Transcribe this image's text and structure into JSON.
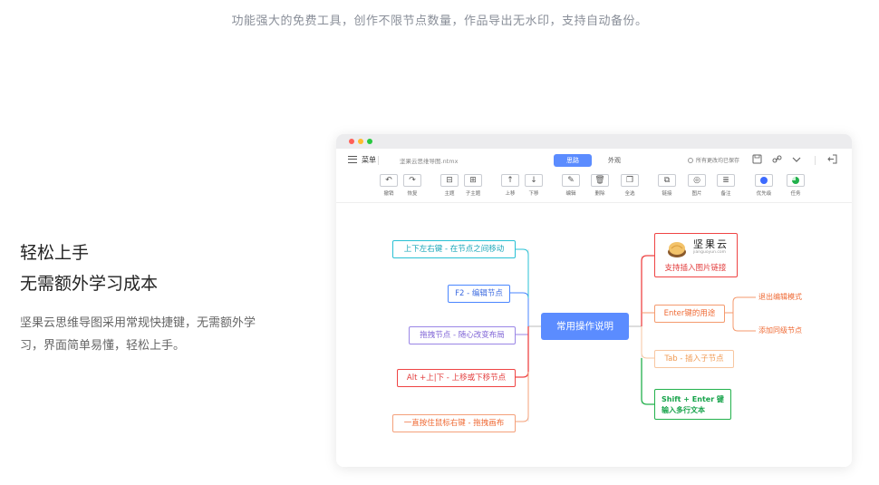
{
  "page": {
    "tagline": "功能强大的免费工具，创作不限节点数量，作品导出无水印，支持自动备份。",
    "feature_title_1": "轻松上手",
    "feature_title_2": "无需额外学习成本",
    "feature_desc": "坚果云思维导图采用常规快捷键，无需额外学习，界面简单易懂，轻松上手。"
  },
  "app": {
    "menu_label": "菜单",
    "filename": "坚果云思维导图.ntmx",
    "tabs": [
      {
        "label": "思路",
        "active": true
      },
      {
        "label": "外观",
        "active": false
      }
    ],
    "save_status": "所有更改均已保存",
    "topbar_icons": [
      "save-icon",
      "link-icon",
      "chevron-down-icon",
      "exit-icon"
    ],
    "toolbar": [
      {
        "label": "撤销",
        "icon": "undo-icon"
      },
      {
        "label": "恢复",
        "icon": "redo-icon"
      },
      {
        "label": "主题",
        "icon": "topic-icon"
      },
      {
        "label": "子主题",
        "icon": "subtopic-icon"
      },
      {
        "label": "上移",
        "icon": "arrow-up-icon"
      },
      {
        "label": "下移",
        "icon": "arrow-down-icon"
      },
      {
        "label": "编辑",
        "icon": "edit-icon"
      },
      {
        "label": "删除",
        "icon": "trash-icon"
      },
      {
        "label": "全选",
        "icon": "select-all-icon"
      },
      {
        "label": "链接",
        "icon": "link-icon"
      },
      {
        "label": "图片",
        "icon": "image-icon"
      },
      {
        "label": "备注",
        "icon": "note-icon"
      },
      {
        "label": "优先级",
        "icon": "priority-icon"
      },
      {
        "label": "任务",
        "icon": "task-progress-icon"
      }
    ]
  },
  "mindmap": {
    "center": "常用操作说明",
    "left": [
      "上下左右键 - 在节点之间移动",
      "F2 - 编辑节点",
      "拖拽节点 - 随心改变布局",
      "Alt +上|下 - 上移或下移节点",
      "一直按住鼠标右键 - 拖拽画布"
    ],
    "right_image_node": {
      "logo_text": "坚果云",
      "logo_sub": "jianguoyun.com",
      "caption": "支持插入图片链接"
    },
    "right": [
      "Enter键的用途",
      "Tab - 插入子节点",
      "Shift + Enter 键\n输入多行文本"
    ],
    "enter_children": [
      "退出编辑模式",
      "添加同级节点"
    ]
  },
  "colors": {
    "accent": "#5b8cff",
    "cyan": "#29c1d4",
    "blue": "#4a86ff",
    "purple": "#9a86e6",
    "red": "#ef4444",
    "orange": "#ef6b36",
    "light_orange": "#f7c6a0",
    "green": "#22b14c"
  }
}
